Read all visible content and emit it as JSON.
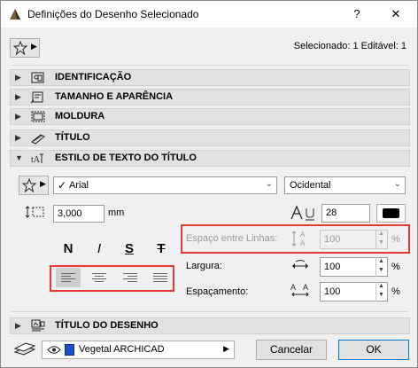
{
  "window": {
    "title": "Definições do Desenho Selecionado",
    "help_label": "?",
    "close_label": "✕"
  },
  "header": {
    "selection_info": "Selecionado: 1 Editável: 1"
  },
  "sections": [
    {
      "label": "IDENTIFICAÇÃO",
      "expanded": false
    },
    {
      "label": "TAMANHO E APARÊNCIA",
      "expanded": false
    },
    {
      "label": "MOLDURA",
      "expanded": false
    },
    {
      "label": "TÍTULO",
      "expanded": false
    },
    {
      "label": "ESTILO DE TEXTO DO TÍTULO",
      "expanded": true
    },
    {
      "label": "TÍTULO DO DESENHO",
      "expanded": false
    }
  ],
  "text_style": {
    "font": "Arial",
    "script": "Ocidental",
    "font_size_value": "3,000",
    "font_size_unit": "mm",
    "pen_value": "28",
    "style_buttons": {
      "bold": "N",
      "italic": "I",
      "underline": "S",
      "strikethrough": "T"
    },
    "line_spacing_label": "Espaço entre Linhas:",
    "line_spacing_value": "100",
    "width_label": "Largura:",
    "width_value": "100",
    "spacing_label": "Espaçamento:",
    "spacing_value": "100",
    "percent": "%"
  },
  "footer": {
    "layer_name": "Vegetal ARCHICAD",
    "cancel_label": "Cancelar",
    "ok_label": "OK"
  },
  "icons": [
    "app-icon",
    "favorites-star-icon",
    "identification-icon",
    "size-appearance-icon",
    "frame-icon",
    "title-icon",
    "text-style-icon",
    "drawing-title-icon",
    "font-size-icon",
    "pen-icon",
    "line-spacing-icon",
    "width-icon",
    "spacing-icon",
    "layer-icon",
    "eye-icon"
  ],
  "colors": {
    "highlight": "#e53935",
    "accent": "#0078d7"
  }
}
